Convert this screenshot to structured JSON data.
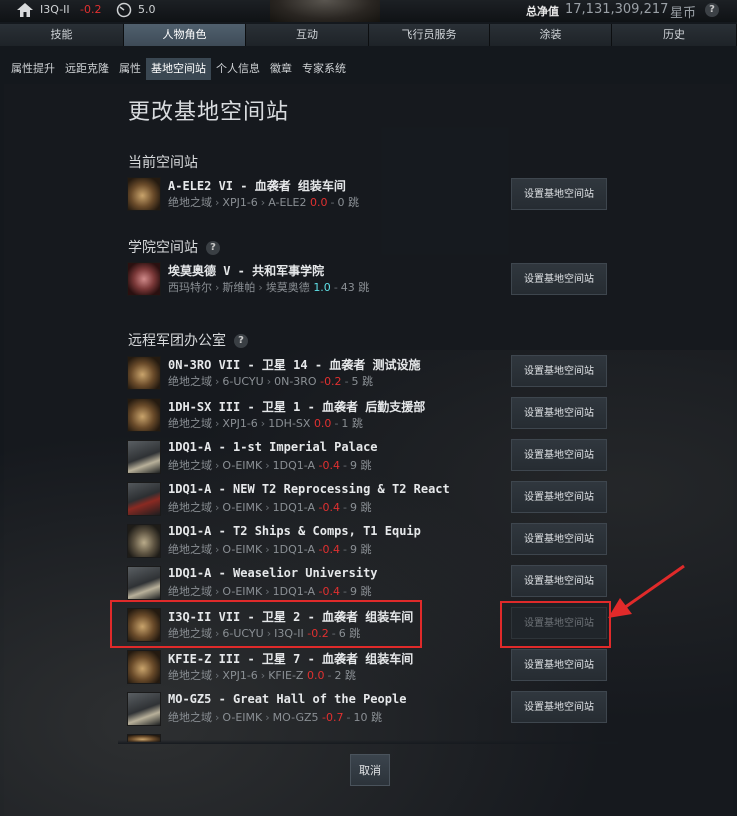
{
  "topbar": {
    "location": "I3Q-II",
    "security": "-0.2",
    "speed": "5.0",
    "net_worth_label": "总净值",
    "net_worth_value": "17,131,309,217",
    "currency": "星币",
    "help": "?"
  },
  "main_tabs": [
    {
      "label": "技能"
    },
    {
      "label": "人物角色",
      "active": true
    },
    {
      "label": "互动"
    },
    {
      "label": "飞行员服务"
    },
    {
      "label": "涂装"
    },
    {
      "label": "历史"
    }
  ],
  "sub_tabs": [
    {
      "label": "属性提升"
    },
    {
      "label": "远距克隆"
    },
    {
      "label": "属性"
    },
    {
      "label": "基地空间站",
      "active": true
    },
    {
      "label": "个人信息"
    },
    {
      "label": "徽章"
    },
    {
      "label": "专家系统"
    }
  ],
  "page_title": "更改基地空间站",
  "sections": {
    "current": "当前空间站",
    "academy": "学院空间站",
    "remote": "远程军团办公室"
  },
  "help_icon": "?",
  "button_label": "设置基地空间站",
  "current_station": {
    "name": "A-ELE2 VI - 血袭者 组装车间",
    "region": "绝地之域",
    "constellation": "XPJ1-6",
    "system": "A-ELE2",
    "sec": "0.0",
    "jumps": "0 跳"
  },
  "academy_station": {
    "name": "埃莫奥德 V - 共和军事学院",
    "region": "西玛特尔",
    "constellation": "斯维帕",
    "system": "埃莫奥德",
    "sec": "1.0",
    "jumps": "43 跳"
  },
  "remote_stations": [
    {
      "name": "0N-3RO VII - 卫星 14 - 血袭者 测试设施",
      "region": "绝地之域",
      "constellation": "6-UCYU",
      "system": "0N-3RO",
      "sec": "-0.2",
      "jumps": "5 跳"
    },
    {
      "name": "1DH-SX III - 卫星 1 - 血袭者 后勤支援部",
      "region": "绝地之域",
      "constellation": "XPJ1-6",
      "system": "1DH-SX",
      "sec": "0.0",
      "jumps": "1 跳"
    },
    {
      "name": "1DQ1-A - 1-st Imperial Palace",
      "region": "绝地之域",
      "constellation": "O-EIMK",
      "system": "1DQ1-A",
      "sec": "-0.4",
      "jumps": "9 跳"
    },
    {
      "name": "1DQ1-A - NEW T2 Reprocessing & T2 React",
      "region": "绝地之域",
      "constellation": "O-EIMK",
      "system": "1DQ1-A",
      "sec": "-0.4",
      "jumps": "9 跳"
    },
    {
      "name": "1DQ1-A - T2 Ships & Comps, T1 Equip",
      "region": "绝地之域",
      "constellation": "O-EIMK",
      "system": "1DQ1-A",
      "sec": "-0.4",
      "jumps": "9 跳"
    },
    {
      "name": "1DQ1-A - Weaselior University",
      "region": "绝地之域",
      "constellation": "O-EIMK",
      "system": "1DQ1-A",
      "sec": "-0.4",
      "jumps": "9 跳"
    },
    {
      "name": "I3Q-II VII - 卫星 2 - 血袭者 组装车间",
      "region": "绝地之域",
      "constellation": "6-UCYU",
      "system": "I3Q-II",
      "sec": "-0.2",
      "jumps": "6 跳",
      "disabled": true
    },
    {
      "name": "KFIE-Z III - 卫星 7 - 血袭者 组装车间",
      "region": "绝地之域",
      "constellation": "XPJ1-6",
      "system": "KFIE-Z",
      "sec": "0.0",
      "jumps": "2 跳"
    },
    {
      "name": "MO-GZ5 - Great Hall of the People",
      "region": "绝地之域",
      "constellation": "O-EIMK",
      "system": "MO-GZ5",
      "sec": "-0.7",
      "jumps": "10 跳"
    }
  ],
  "cancel_label": "取消"
}
